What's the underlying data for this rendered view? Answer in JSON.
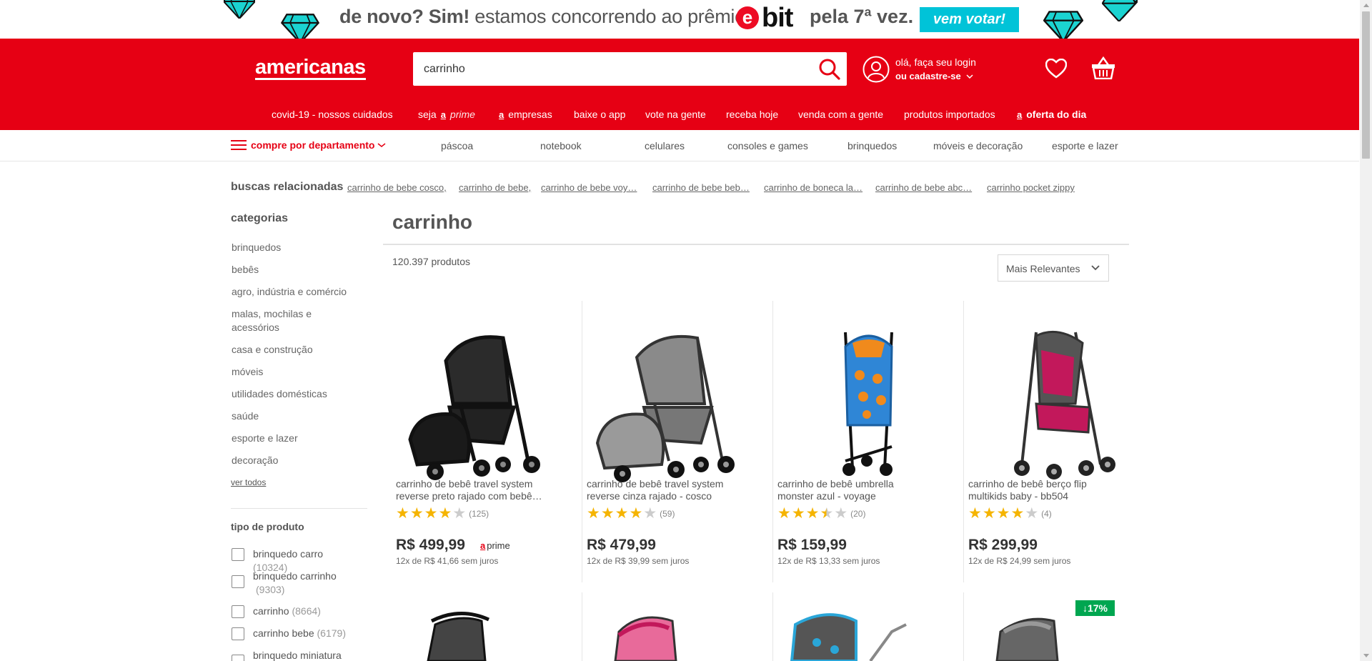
{
  "colors": {
    "brand_red": "#e60014",
    "promo_cyan": "#00c3d8",
    "star": "#f5b400",
    "discount_green": "#00a650"
  },
  "promo": {
    "text_before": "de novo? Sim!",
    "text_mid": " estamos concorrendo ao prêmio",
    "ebit_e": "e",
    "ebit_rest": "bit",
    "text_after": "pela 7ª vez.",
    "cta": "vem votar!",
    "icons": [
      "diamond-icon",
      "diamond-icon",
      "diamond-icon",
      "diamond-icon",
      "diamond-icon"
    ]
  },
  "header": {
    "logo": "americanas",
    "search_value": "carrinho",
    "account_line1": "olá, faça seu login",
    "account_line2": "ou cadastre-se",
    "icons": [
      "search-icon",
      "user-icon",
      "heart-icon",
      "basket-icon"
    ]
  },
  "nav": {
    "covid": "covid-19 - nossos cuidados",
    "seja": "seja",
    "a_mark": "a",
    "prime": "prime",
    "empresas": "empresas",
    "app": "baixe o app",
    "vote": "vote na gente",
    "receba": "receba hoje",
    "venda": "venda com a gente",
    "importados": "produtos importados",
    "oferta": "oferta do dia"
  },
  "dept": {
    "menu_label": "compre por departamento",
    "items": [
      "páscoa",
      "notebook",
      "celulares",
      "consoles e games",
      "brinquedos",
      "móveis e decoração",
      "esporte e lazer"
    ]
  },
  "related": {
    "label": "buscas relacionadas",
    "links": [
      "carrinho de bebe cosco,",
      "carrinho de bebe,",
      "carrinho de bebe voy…",
      "carrinho de bebe beb…",
      "carrinho de boneca la…",
      "carrinho de bebe abc…",
      "carrinho pocket zippy"
    ]
  },
  "sidebar": {
    "title": "categorias",
    "categories": [
      "brinquedos",
      "bebês",
      "agro, indústria e comércio",
      "malas, mochilas e acessórios",
      "casa e construção",
      "móveis",
      "utilidades domésticas",
      "saúde",
      "esporte e lazer",
      "decoração"
    ],
    "see_all": "ver todos",
    "filter_title": "tipo de produto",
    "filters": [
      {
        "label": "brinquedo carro",
        "count": "(10324)"
      },
      {
        "label": "brinquedo carrinho",
        "count": "(9303)"
      },
      {
        "label": "carrinho",
        "count": "(8664)"
      },
      {
        "label": "carrinho bebe",
        "count": "(6179)"
      },
      {
        "label": "brinquedo miniatura",
        "count": ""
      }
    ]
  },
  "results": {
    "title": "carrinho",
    "count": "120.397 produtos",
    "sort": "Mais Relevantes",
    "products": [
      {
        "name": "carrinho de bebê travel system reverse preto rajado com bebê…",
        "rating": 4,
        "reviews": "(125)",
        "price": "R$ 499,99",
        "prime_a": "a",
        "prime": "prime",
        "installments": "12x de R$ 41,66 sem juros",
        "image": "stroller-black"
      },
      {
        "name": "carrinho de bebê travel system reverse cinza rajado - cosco",
        "rating": 4,
        "reviews": "(59)",
        "price": "R$ 479,99",
        "installments": "12x de R$ 39,99 sem juros",
        "image": "stroller-grey"
      },
      {
        "name": "carrinho de bebê umbrella monster azul - voyage",
        "rating": 3.5,
        "reviews": "(20)",
        "price": "R$ 159,99",
        "installments": "12x de R$ 13,33 sem juros",
        "image": "stroller-blue"
      },
      {
        "name": "carrinho de bebê berço flip multikids baby - bb504",
        "rating": 4,
        "reviews": "(4)",
        "price": "R$ 299,99",
        "installments": "12x de R$ 24,99 sem juros",
        "image": "stroller-pink"
      }
    ],
    "discount_badge": "↓17%"
  }
}
